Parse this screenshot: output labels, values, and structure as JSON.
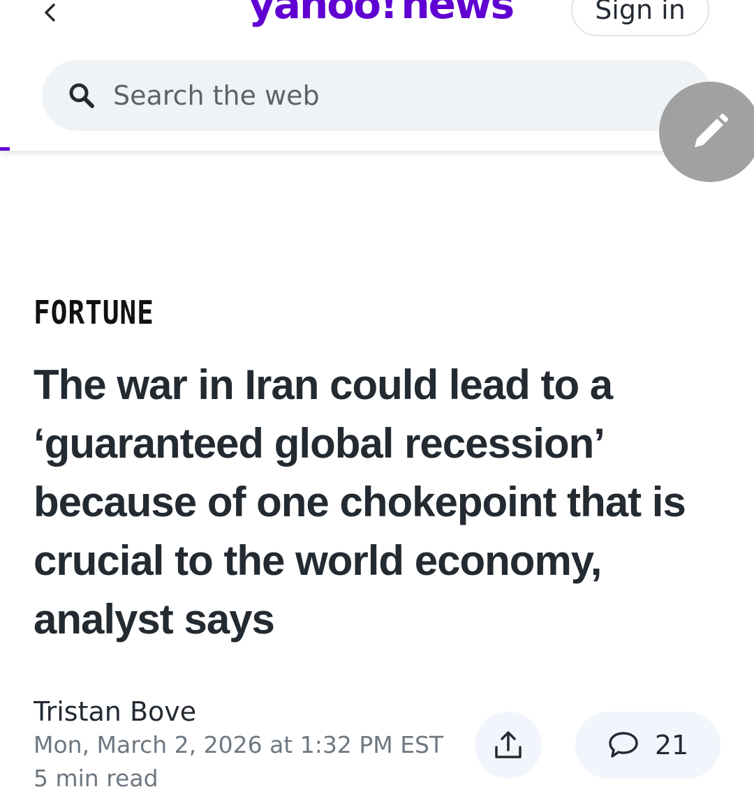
{
  "header": {
    "logo_brand": "yahoo!",
    "logo_suffix": "news",
    "signin_label": "Sign in",
    "search_placeholder": "Search the web",
    "accent_color": "#6001d2"
  },
  "icons": {
    "back": "chevron-left-icon",
    "search": "search-icon",
    "edit": "pencil-icon",
    "share": "share-icon",
    "comment": "comment-bubble-icon"
  },
  "article": {
    "publisher": "FORTUNE",
    "headline": "The war in Iran could lead to a ‘guaranteed global recession’ because of one chokepoint that is crucial to the world economy, analyst says",
    "author": "Tristan Bove",
    "date": "Mon, March 2, 2026 at 1:32 PM EST",
    "read_time": "5 min read",
    "comment_count": "21"
  }
}
